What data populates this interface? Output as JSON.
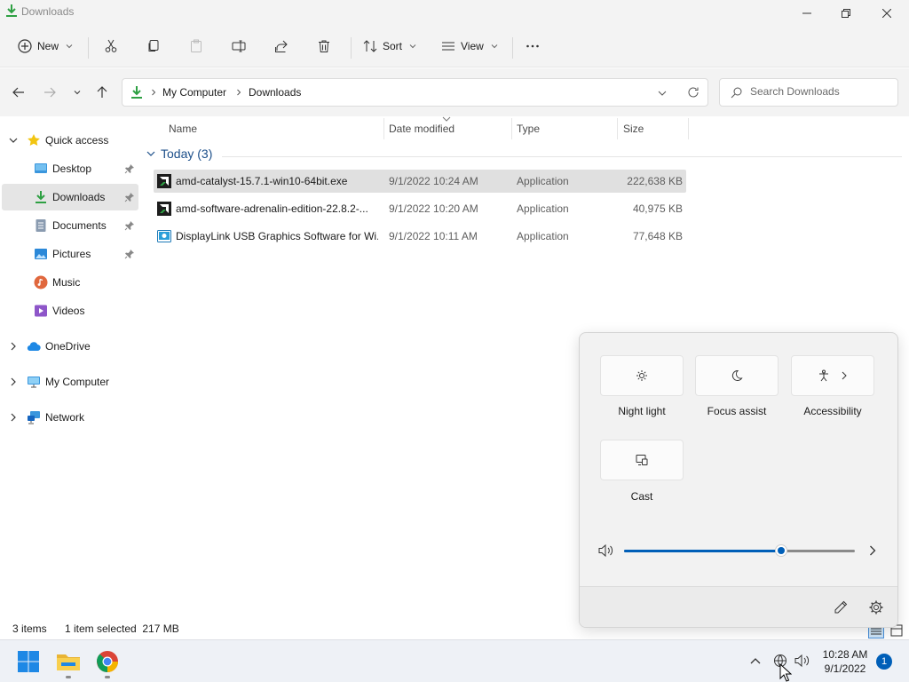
{
  "window": {
    "title": "Downloads"
  },
  "toolbar": {
    "new_label": "New",
    "sort_label": "Sort",
    "view_label": "View"
  },
  "address": {
    "crumbs": [
      "My Computer",
      "Downloads"
    ],
    "search_placeholder": "Search Downloads"
  },
  "sidebar": {
    "quick_access": "Quick access",
    "items": [
      {
        "label": "Desktop",
        "icon": "desktop-icon",
        "pinned": true
      },
      {
        "label": "Downloads",
        "icon": "download-icon",
        "pinned": true
      },
      {
        "label": "Documents",
        "icon": "documents-icon",
        "pinned": true
      },
      {
        "label": "Pictures",
        "icon": "pictures-icon",
        "pinned": true
      },
      {
        "label": "Music",
        "icon": "music-icon",
        "pinned": false
      },
      {
        "label": "Videos",
        "icon": "videos-icon",
        "pinned": false
      }
    ],
    "roots": [
      {
        "label": "OneDrive",
        "icon": "cloud-icon"
      },
      {
        "label": "My Computer",
        "icon": "computer-icon"
      },
      {
        "label": "Network",
        "icon": "network-icon"
      }
    ]
  },
  "columns": {
    "name": "Name",
    "date": "Date modified",
    "type": "Type",
    "size": "Size"
  },
  "group": {
    "label": "Today (3)"
  },
  "files": [
    {
      "name": "amd-catalyst-15.7.1-win10-64bit.exe",
      "date": "9/1/2022 10:24 AM",
      "type": "Application",
      "size": "222,638 KB",
      "selected": true
    },
    {
      "name": "amd-software-adrenalin-edition-22.8.2-...",
      "date": "9/1/2022 10:20 AM",
      "type": "Application",
      "size": "40,975 KB",
      "selected": false
    },
    {
      "name": "DisplayLink USB Graphics Software for Wi...",
      "date": "9/1/2022 10:11 AM",
      "type": "Application",
      "size": "77,648 KB",
      "selected": false
    }
  ],
  "status": {
    "items": "3 items",
    "selection": "1 item selected  217 MB"
  },
  "quick_settings": {
    "tiles": [
      {
        "label": "Night light",
        "icon": "brightness-icon"
      },
      {
        "label": "Focus assist",
        "icon": "moon-icon"
      },
      {
        "label": "Accessibility",
        "icon": "accessibility-icon"
      },
      {
        "label": "Cast",
        "icon": "cast-icon"
      }
    ],
    "volume_level": 0.68
  },
  "taskbar": {
    "time": "10:28 AM",
    "date": "9/1/2022",
    "notification_count": "1"
  },
  "colors": {
    "accent": "#005fb8",
    "group_header": "#1c4f8a",
    "selection": "#e0e0e0"
  }
}
